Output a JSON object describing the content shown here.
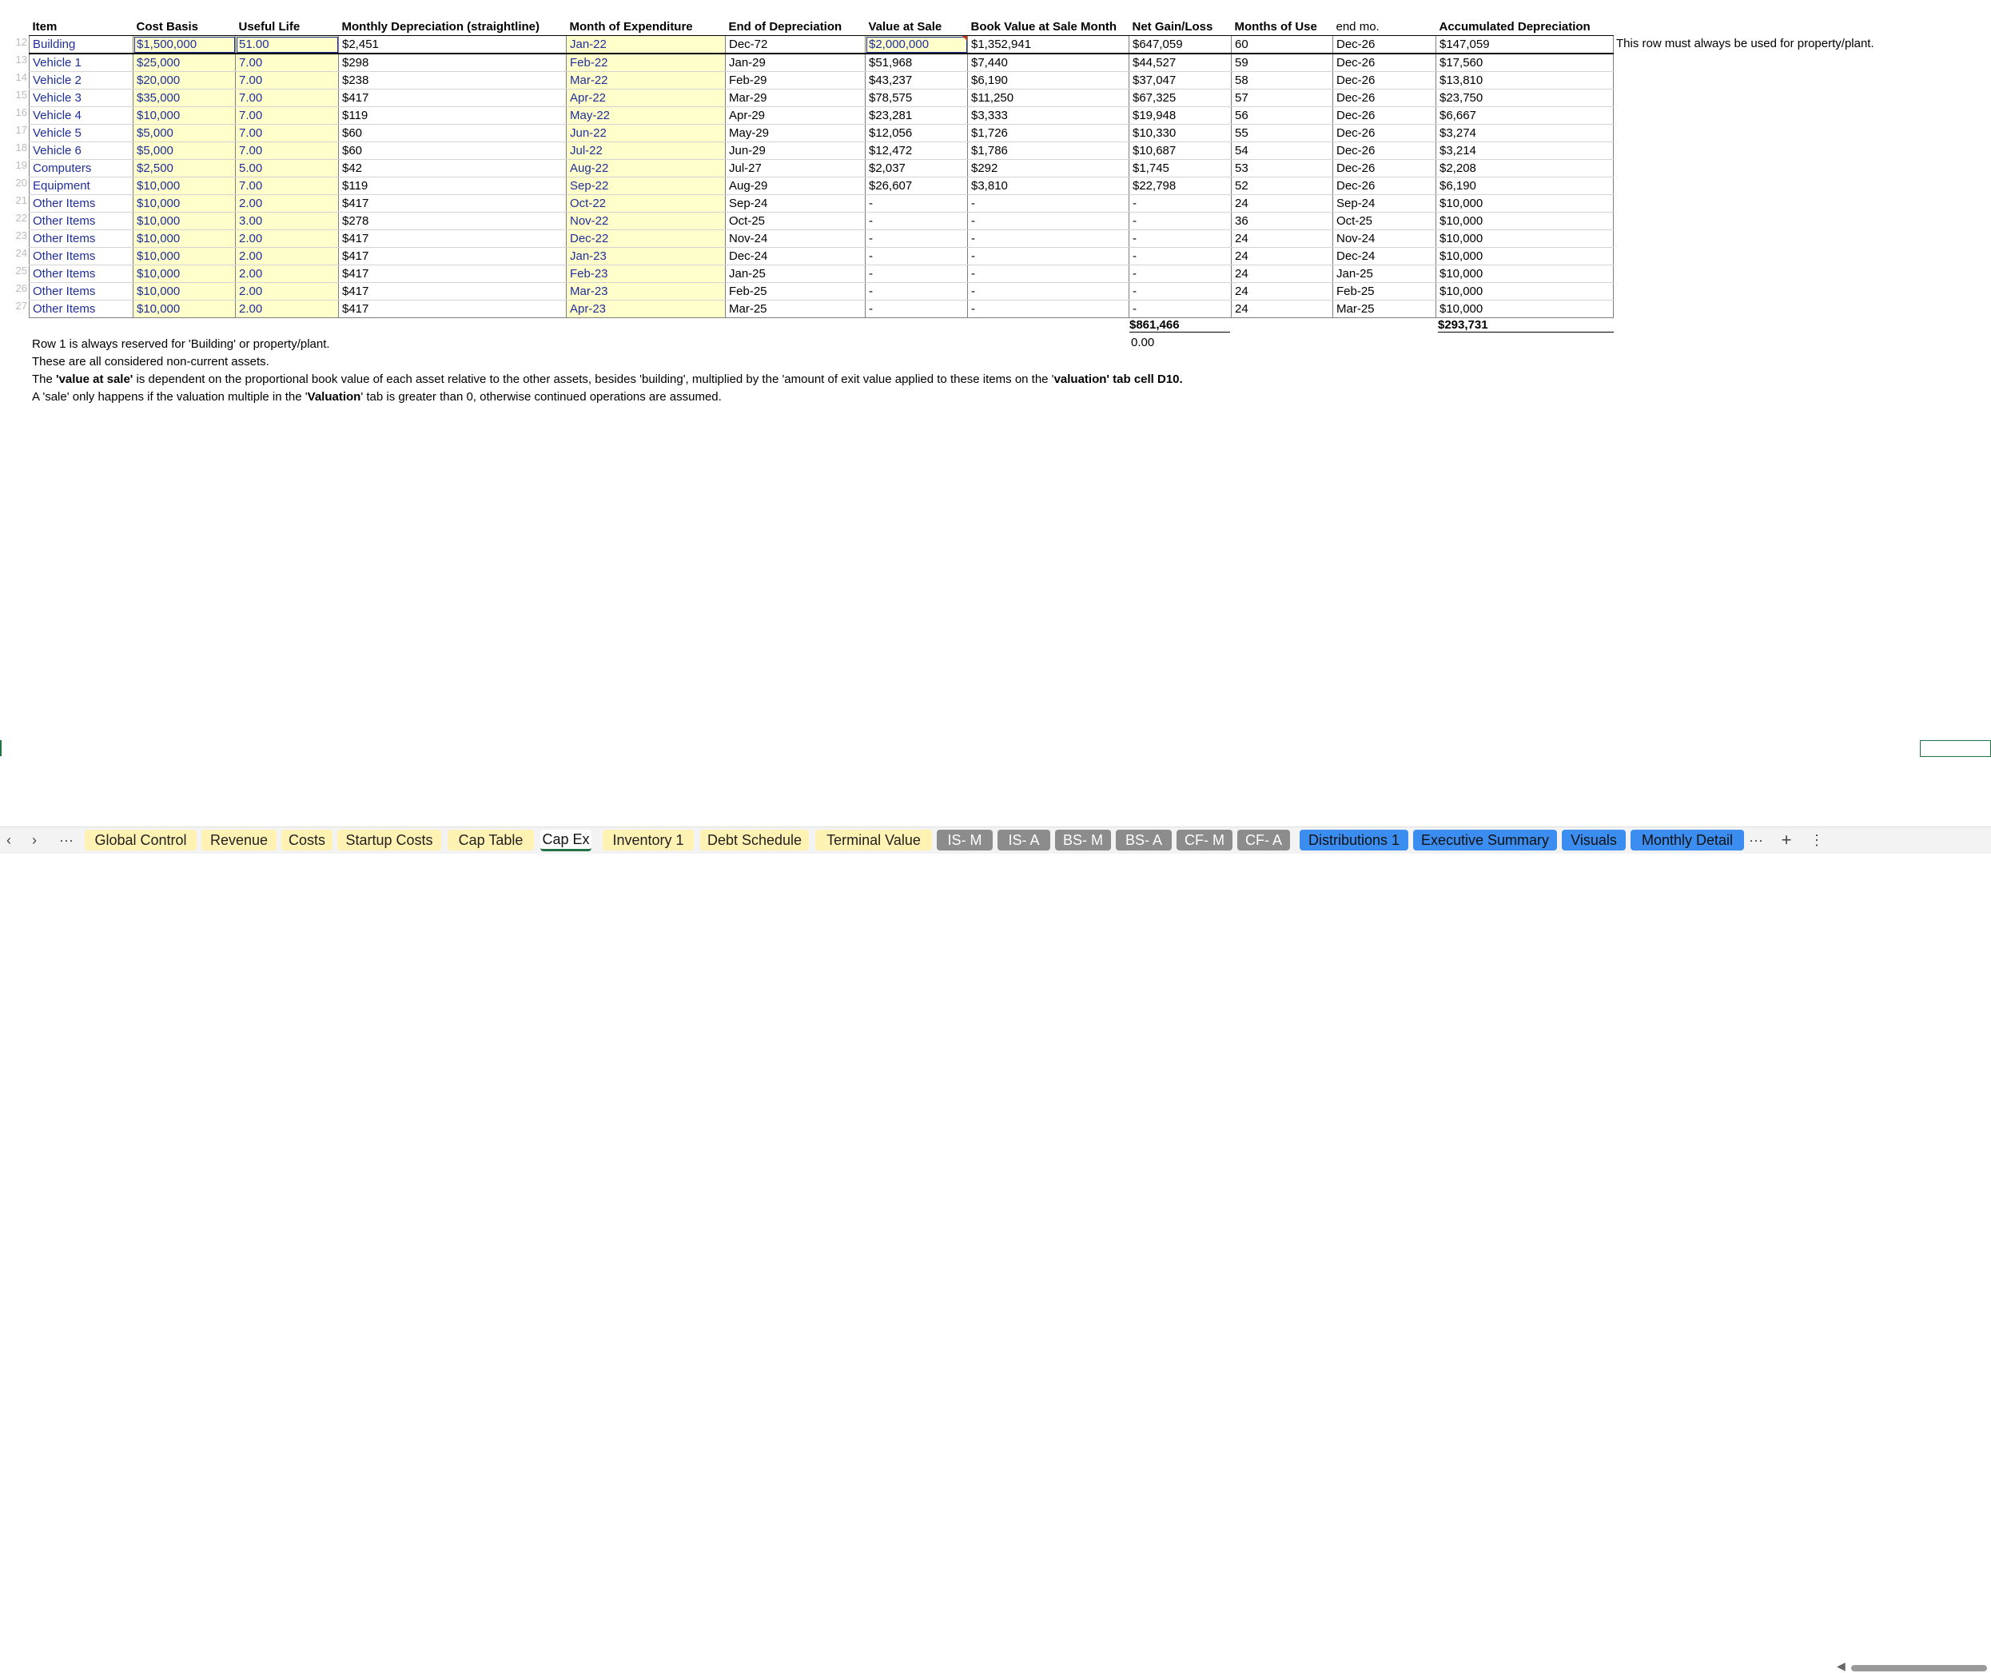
{
  "columns": [
    "Item",
    "Cost Basis",
    "Useful Life",
    "Monthly Depreciation (straightline)",
    "Month of Expenditure",
    "End of Depreciation",
    "Value at Sale",
    "Book Value at Sale Month",
    "Net Gain/Loss",
    "Months of Use",
    "end mo.",
    "Accumulated Depreciation"
  ],
  "row_numbers": [
    "12",
    "13",
    "14",
    "15",
    "16",
    "17",
    "18",
    "19",
    "20",
    "21",
    "22",
    "23",
    "24",
    "25",
    "26",
    "27"
  ],
  "rows": [
    [
      "Building",
      "$1,500,000",
      "51.00",
      "$2,451",
      "Jan-22",
      "Dec-72",
      "$2,000,000",
      "$1,352,941",
      "$647,059",
      "60",
      "Dec-26",
      "$147,059"
    ],
    [
      "Vehicle 1",
      "$25,000",
      "7.00",
      "$298",
      "Feb-22",
      "Jan-29",
      "$51,968",
      "$7,440",
      "$44,527",
      "59",
      "Dec-26",
      "$17,560"
    ],
    [
      "Vehicle 2",
      "$20,000",
      "7.00",
      "$238",
      "Mar-22",
      "Feb-29",
      "$43,237",
      "$6,190",
      "$37,047",
      "58",
      "Dec-26",
      "$13,810"
    ],
    [
      "Vehicle 3",
      "$35,000",
      "7.00",
      "$417",
      "Apr-22",
      "Mar-29",
      "$78,575",
      "$11,250",
      "$67,325",
      "57",
      "Dec-26",
      "$23,750"
    ],
    [
      "Vehicle 4",
      "$10,000",
      "7.00",
      "$119",
      "May-22",
      "Apr-29",
      "$23,281",
      "$3,333",
      "$19,948",
      "56",
      "Dec-26",
      "$6,667"
    ],
    [
      "Vehicle 5",
      "$5,000",
      "7.00",
      "$60",
      "Jun-22",
      "May-29",
      "$12,056",
      "$1,726",
      "$10,330",
      "55",
      "Dec-26",
      "$3,274"
    ],
    [
      "Vehicle 6",
      "$5,000",
      "7.00",
      "$60",
      "Jul-22",
      "Jun-29",
      "$12,472",
      "$1,786",
      "$10,687",
      "54",
      "Dec-26",
      "$3,214"
    ],
    [
      "Computers",
      "$2,500",
      "5.00",
      "$42",
      "Aug-22",
      "Jul-27",
      "$2,037",
      "$292",
      "$1,745",
      "53",
      "Dec-26",
      "$2,208"
    ],
    [
      "Equipment",
      "$10,000",
      "7.00",
      "$119",
      "Sep-22",
      "Aug-29",
      "$26,607",
      "$3,810",
      "$22,798",
      "52",
      "Dec-26",
      "$6,190"
    ],
    [
      "Other Items",
      "$10,000",
      "2.00",
      "$417",
      "Oct-22",
      "Sep-24",
      "-",
      "-",
      "-",
      "24",
      "Sep-24",
      "$10,000"
    ],
    [
      "Other Items",
      "$10,000",
      "3.00",
      "$278",
      "Nov-22",
      "Oct-25",
      "-",
      "-",
      "-",
      "36",
      "Oct-25",
      "$10,000"
    ],
    [
      "Other Items",
      "$10,000",
      "2.00",
      "$417",
      "Dec-22",
      "Nov-24",
      "-",
      "-",
      "-",
      "24",
      "Nov-24",
      "$10,000"
    ],
    [
      "Other Items",
      "$10,000",
      "2.00",
      "$417",
      "Jan-23",
      "Dec-24",
      "-",
      "-",
      "-",
      "24",
      "Dec-24",
      "$10,000"
    ],
    [
      "Other Items",
      "$10,000",
      "2.00",
      "$417",
      "Feb-23",
      "Jan-25",
      "-",
      "-",
      "-",
      "24",
      "Jan-25",
      "$10,000"
    ],
    [
      "Other Items",
      "$10,000",
      "2.00",
      "$417",
      "Mar-23",
      "Feb-25",
      "-",
      "-",
      "-",
      "24",
      "Feb-25",
      "$10,000"
    ],
    [
      "Other Items",
      "$10,000",
      "2.00",
      "$417",
      "Apr-23",
      "Mar-25",
      "-",
      "-",
      "-",
      "24",
      "Mar-25",
      "$10,000"
    ]
  ],
  "side_note": "This row must always be used for property/plant.",
  "totals": {
    "net_gain": "$861,466",
    "accumulated": "$293,731",
    "check": "0.00"
  },
  "notes": {
    "line1": "Row 1 is always reserved for 'Building' or property/plant.",
    "line2": "These are all considered non-current assets.",
    "line3_a": "The ",
    "line3_b": "'value at sale'",
    "line3_c": " is dependent on the proportional book value of each asset relative to the other assets, besides 'building', multiplied by the 'amount of exit value applied to these items on the '",
    "line3_d": "valuation",
    "line3_e": "' tab cell D10.",
    "line4_a": "A 'sale' only happens if the valuation multiple in the '",
    "line4_b": "Valuation",
    "line4_c": "' tab is greater than 0, otherwise continued operations are assumed."
  },
  "tabs": [
    {
      "label": "Global Control",
      "style": "yellow"
    },
    {
      "label": "Revenue",
      "style": "yellow"
    },
    {
      "label": "Costs",
      "style": "yellow"
    },
    {
      "label": "Startup Costs",
      "style": "yellow"
    },
    {
      "label": "Cap Table",
      "style": "yellow"
    },
    {
      "label": "Cap Ex",
      "style": "active"
    },
    {
      "label": "Inventory 1",
      "style": "yellow"
    },
    {
      "label": "Debt Schedule",
      "style": "yellow"
    },
    {
      "label": "Terminal Value",
      "style": "yellow"
    },
    {
      "label": "IS- M",
      "style": "gray"
    },
    {
      "label": "IS- A",
      "style": "gray"
    },
    {
      "label": "BS- M",
      "style": "gray"
    },
    {
      "label": "BS- A",
      "style": "gray"
    },
    {
      "label": "CF- M",
      "style": "gray"
    },
    {
      "label": "CF- A",
      "style": "gray"
    },
    {
      "label": "Distributions 1",
      "style": "blue"
    },
    {
      "label": "Executive Summary",
      "style": "blue"
    },
    {
      "label": "Visuals",
      "style": "blue"
    },
    {
      "label": "Monthly Detail",
      "style": "blue"
    }
  ],
  "nav": {
    "prev": "‹",
    "next": "›",
    "more_left": "···",
    "more_right": "···",
    "add": "+",
    "options": "⋮"
  }
}
